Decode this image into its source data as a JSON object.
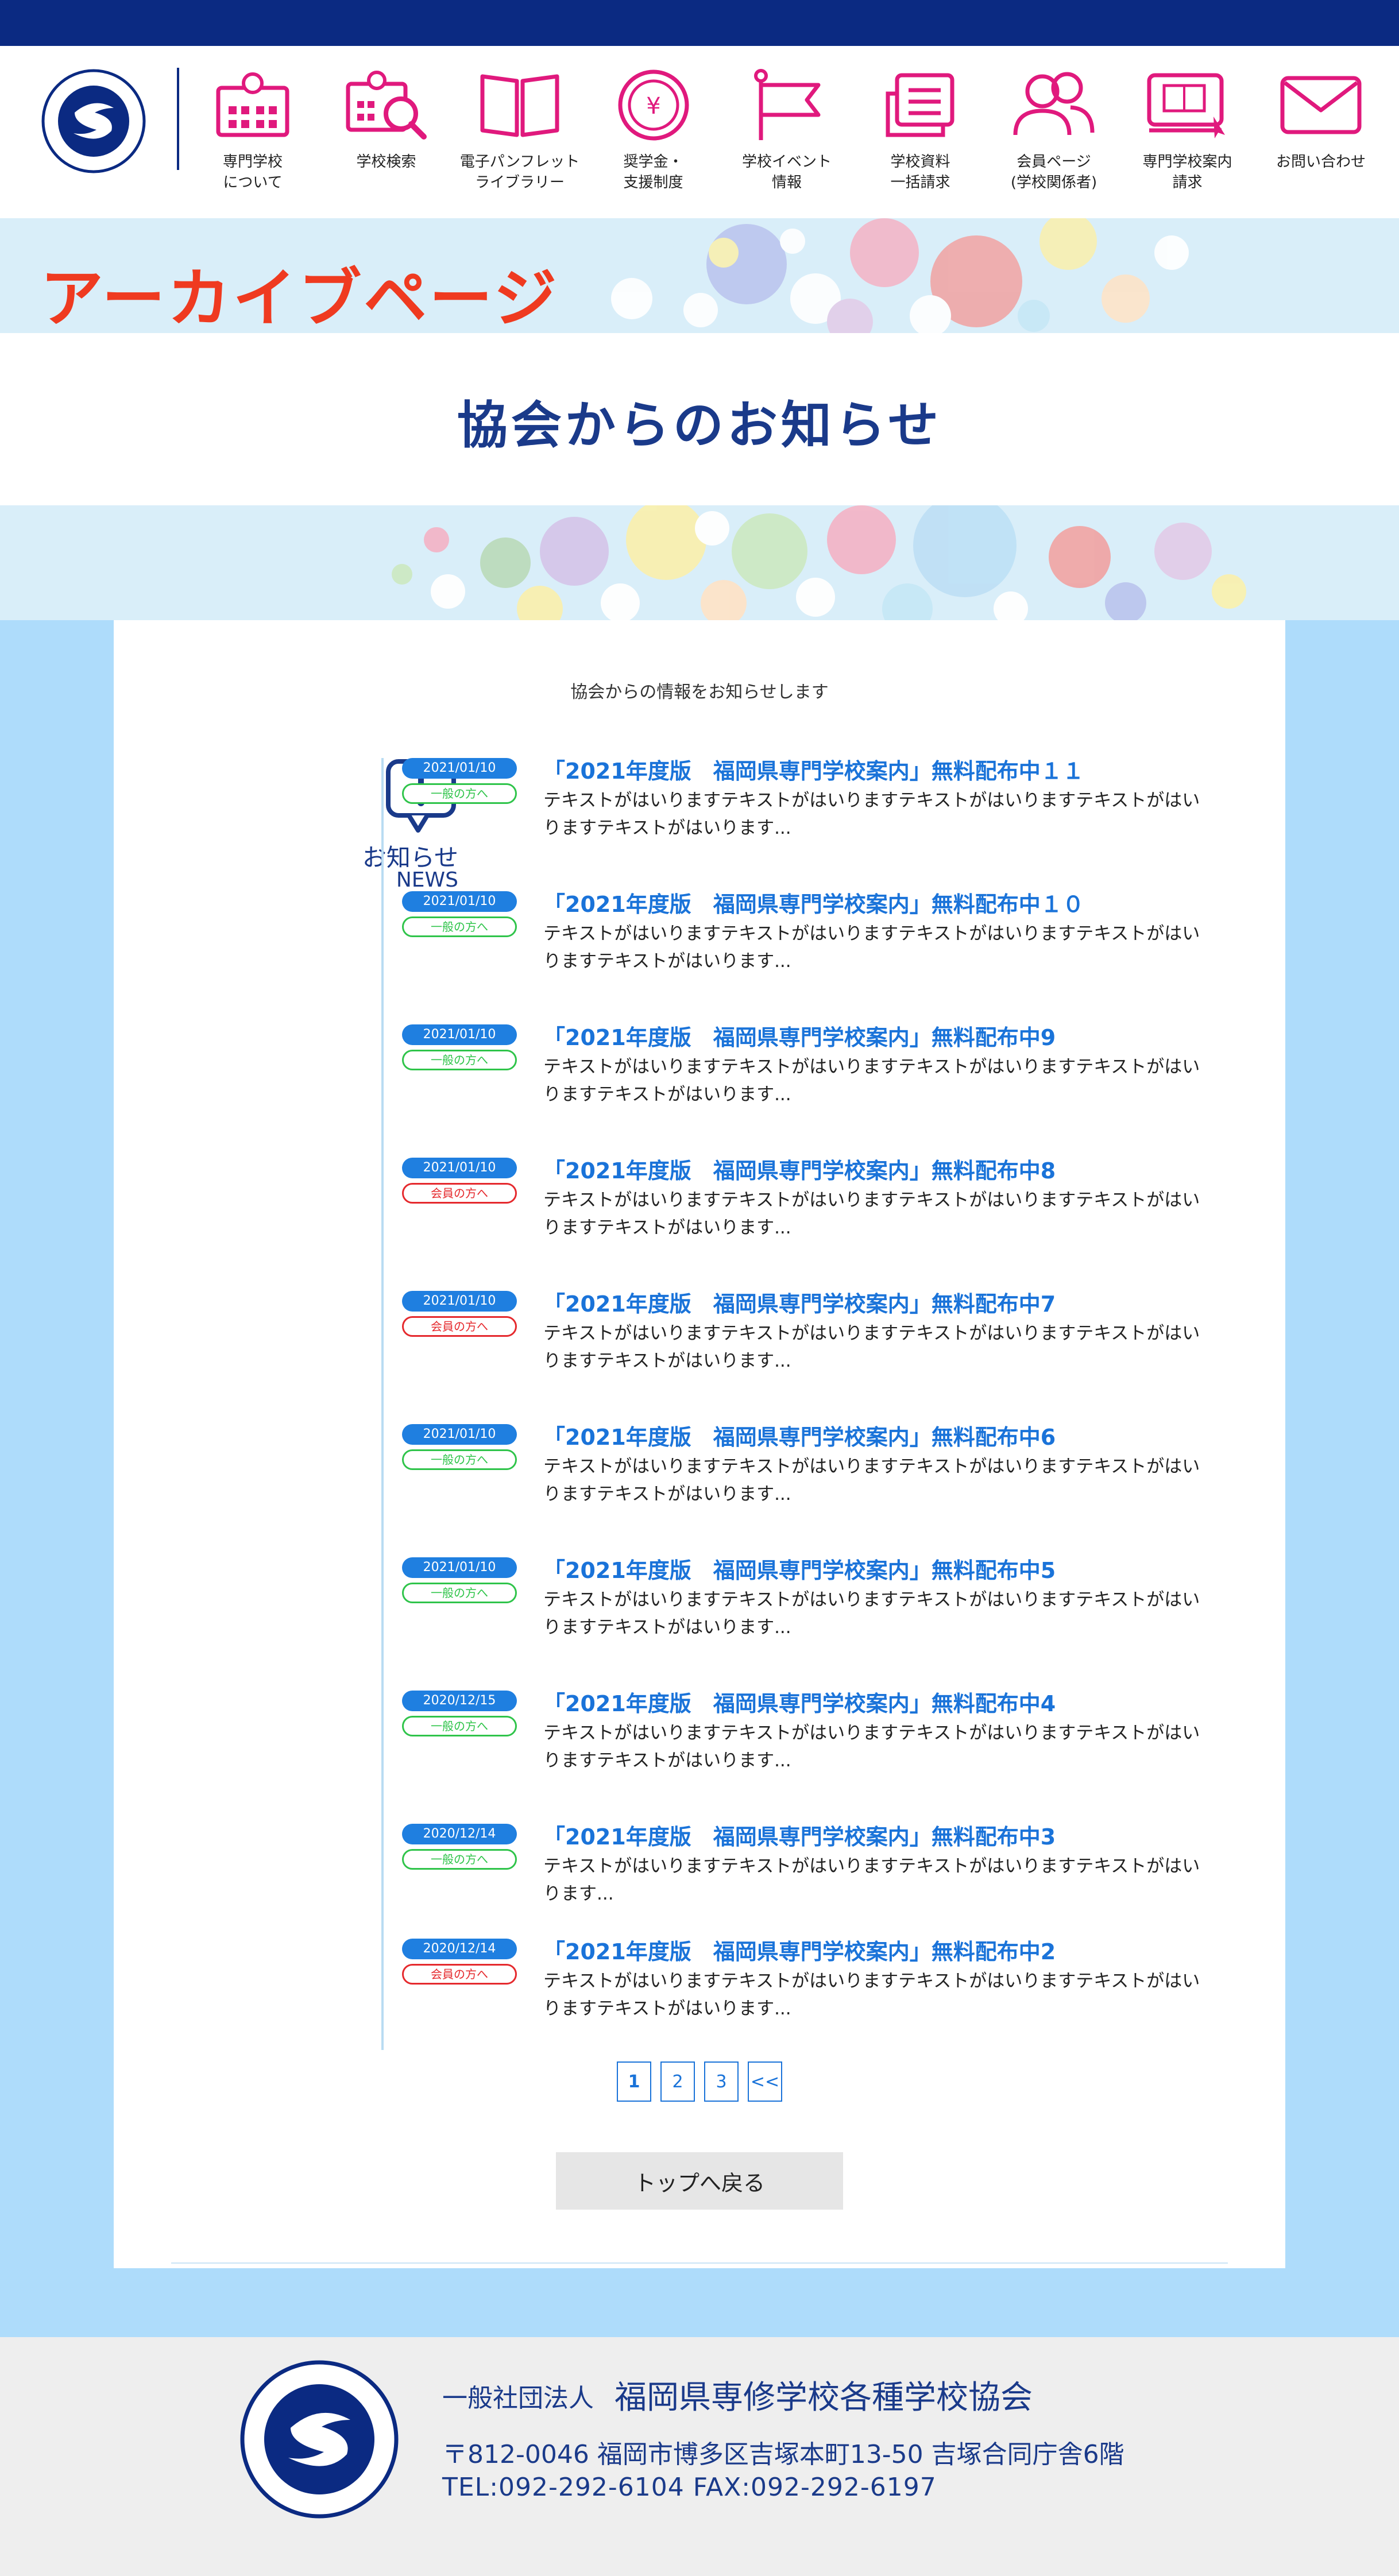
{
  "header": {
    "nav": [
      {
        "label": "専門学校\nについて",
        "icon": "school-building-icon"
      },
      {
        "label": "学校検索",
        "icon": "school-search-icon"
      },
      {
        "label": "電子パンフレット\nライブラリー",
        "icon": "open-book-icon"
      },
      {
        "label": "奨学金・\n支援制度",
        "icon": "yen-coin-icon"
      },
      {
        "label": "学校イベント\n情報",
        "icon": "flag-icon"
      },
      {
        "label": "学校資料\n一括請求",
        "icon": "document-icon"
      },
      {
        "label": "会員ページ\n(学校関係者)",
        "icon": "members-icon"
      },
      {
        "label": "専門学校案内\n請求",
        "icon": "brochure-request-icon"
      },
      {
        "label": "お問い合わせ",
        "icon": "mail-icon"
      }
    ]
  },
  "hero": {
    "archive_label": "アーカイブページ",
    "title": "協会からのお知らせ"
  },
  "content": {
    "intro": "協会からの情報をお知らせします",
    "news_label_jp": "お知らせ",
    "news_label_en": "NEWS",
    "news": [
      {
        "date": "2021/01/10",
        "tag": "一般の方へ",
        "member": false,
        "title": "「2021年度版　福岡県専門学校案内」無料配布中１１",
        "body": "テキストがはいりますテキストがはいりますテキストがはいりますテキストがはいりますテキストがはいります..."
      },
      {
        "date": "2021/01/10",
        "tag": "一般の方へ",
        "member": false,
        "title": "「2021年度版　福岡県専門学校案内」無料配布中１０",
        "body": "テキストがはいりますテキストがはいりますテキストがはいりますテキストがはいりますテキストがはいります..."
      },
      {
        "date": "2021/01/10",
        "tag": "一般の方へ",
        "member": false,
        "title": "「2021年度版　福岡県専門学校案内」無料配布中9",
        "body": "テキストがはいりますテキストがはいりますテキストがはいりますテキストがはいりますテキストがはいります..."
      },
      {
        "date": "2021/01/10",
        "tag": "会員の方へ",
        "member": true,
        "title": "「2021年度版　福岡県専門学校案内」無料配布中8",
        "body": "テキストがはいりますテキストがはいりますテキストがはいりますテキストがはいりますテキストがはいります..."
      },
      {
        "date": "2021/01/10",
        "tag": "会員の方へ",
        "member": true,
        "title": "「2021年度版　福岡県専門学校案内」無料配布中7",
        "body": "テキストがはいりますテキストがはいりますテキストがはいりますテキストがはいりますテキストがはいります..."
      },
      {
        "date": "2021/01/10",
        "tag": "一般の方へ",
        "member": false,
        "title": "「2021年度版　福岡県専門学校案内」無料配布中6",
        "body": "テキストがはいりますテキストがはいりますテキストがはいりますテキストがはいりますテキストがはいります..."
      },
      {
        "date": "2021/01/10",
        "tag": "一般の方へ",
        "member": false,
        "title": "「2021年度版　福岡県専門学校案内」無料配布中5",
        "body": "テキストがはいりますテキストがはいりますテキストがはいりますテキストがはいりますテキストがはいります..."
      },
      {
        "date": "2020/12/15",
        "tag": "一般の方へ",
        "member": false,
        "title": "「2021年度版　福岡県専門学校案内」無料配布中4",
        "body": "テキストがはいりますテキストがはいりますテキストがはいりますテキストがはいりますテキストがはいります..."
      },
      {
        "date": "2020/12/14",
        "tag": "一般の方へ",
        "member": false,
        "title": "「2021年度版　福岡県専門学校案内」無料配布中3",
        "body": "テキストがはいりますテキストがはいりますテキストがはいりますテキストがはいります..."
      },
      {
        "date": "2020/12/14",
        "tag": "会員の方へ",
        "member": true,
        "title": "「2021年度版　福岡県専門学校案内」無料配布中2",
        "body": "テキストがはいりますテキストがはいりますテキストがはいりますテキストがはいりますテキストがはいります..."
      }
    ],
    "pager": [
      "1",
      "2",
      "3",
      "<<"
    ],
    "pager_current": "1",
    "back_button": "トップへ戻る"
  },
  "footer": {
    "org_prefix": "一般社団法人",
    "org_name": "福岡県専修学校各種学校協会",
    "address": "〒812-0046 福岡市博多区吉塚本町13-50 吉塚合同庁舎6階",
    "tel_fax": "TEL:092-292-6104 FAX:092-292-6197",
    "seal_text": "一般社団法人 福岡県専修学校各種学校協会"
  },
  "colors": {
    "navy": "#0b2a82",
    "magenta": "#e0197d",
    "news_blue": "#1a73d9",
    "tag_green": "#2fc44a",
    "tag_red": "#e5292d",
    "hero_red": "#ef3a20",
    "page_bg": "#aedcfb"
  }
}
